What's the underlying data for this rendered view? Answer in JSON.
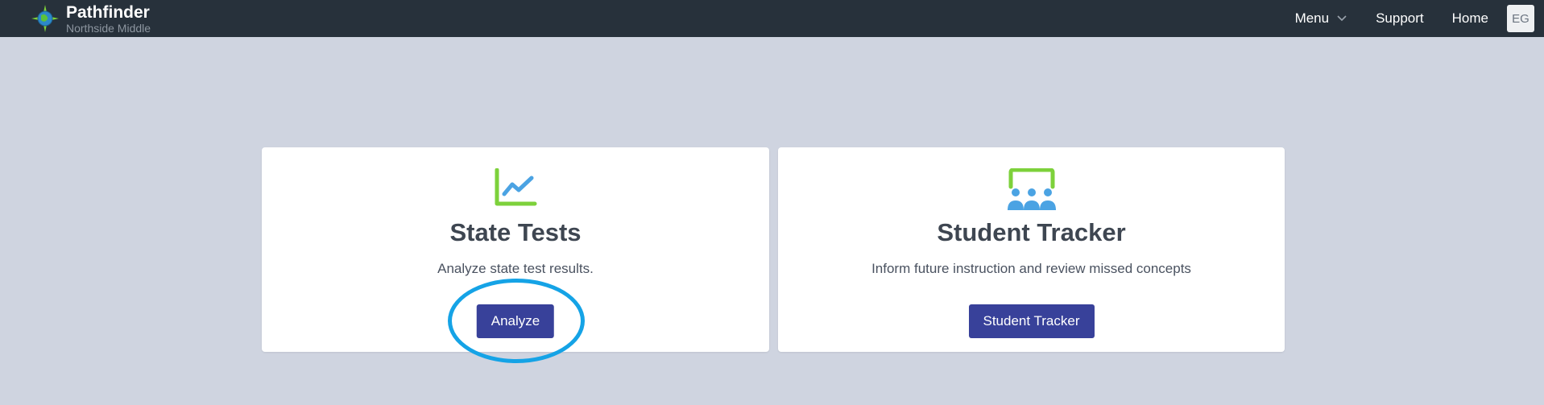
{
  "header": {
    "brand_name": "Pathfinder",
    "school_name": "Northside Middle",
    "nav": {
      "menu_label": "Menu",
      "support_label": "Support",
      "home_label": "Home",
      "avatar_initials": "EG"
    }
  },
  "cards": [
    {
      "icon": "line-chart-icon",
      "title": "State Tests",
      "description": "Analyze state test results.",
      "button_label": "Analyze"
    },
    {
      "icon": "classroom-icon",
      "title": "Student Tracker",
      "description": "Inform future instruction and review missed concepts",
      "button_label": "Student Tracker"
    }
  ],
  "colors": {
    "topbar": "#27313b",
    "background": "#cfd4e0",
    "button": "#38419a",
    "accent_green": "#7dd13b",
    "accent_blue": "#4ba3e3",
    "highlight_ring": "#15a3e6"
  }
}
